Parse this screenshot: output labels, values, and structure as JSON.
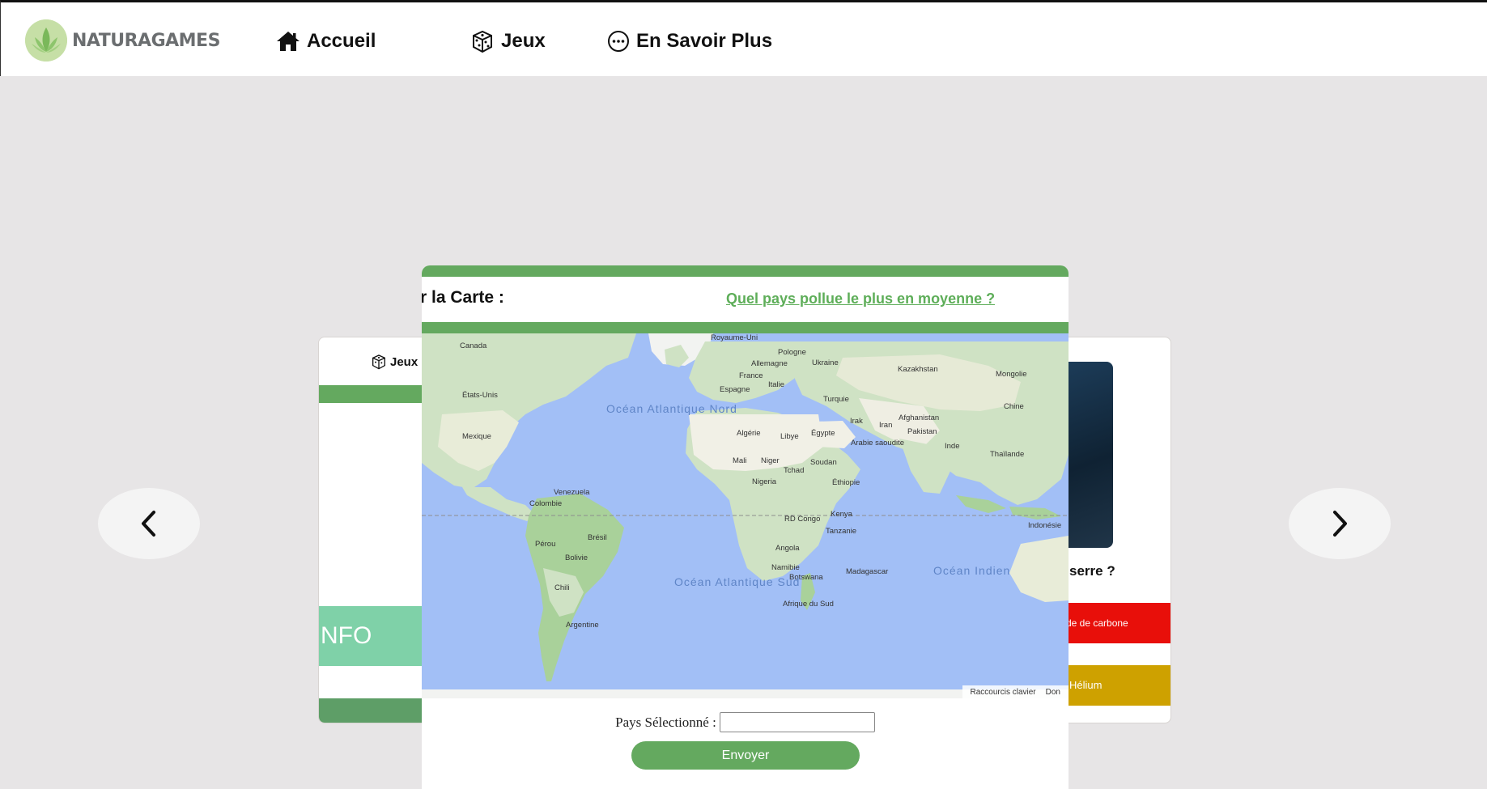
{
  "brand": {
    "logo_text": "NATURAGAMES"
  },
  "nav": [
    {
      "label": "Accueil",
      "icon": "home-icon"
    },
    {
      "label": "Jeux",
      "icon": "dice-icon"
    },
    {
      "label": "En Savoir Plus",
      "icon": "ellipsis-circle-icon"
    }
  ],
  "carousel": {
    "prev_icon": "chevron-left-icon",
    "next_icon": "chevron-right-icon"
  },
  "left_card": {
    "header_label": "Jeux",
    "info_label": "NFO"
  },
  "right_card": {
    "question_fragment": "serre ?",
    "answers": [
      {
        "label": "de de carbone",
        "color": "#e80f0a"
      },
      {
        "label": "Hélium",
        "color": "#cea100"
      }
    ]
  },
  "modal": {
    "heading": "r la Carte :",
    "link_text": "Quel pays pollue le plus en moyenne ?",
    "map": {
      "footer_links": [
        "Raccourcis clavier",
        "Don"
      ],
      "country_labels": [
        "Royaume-Uni",
        "Pologne",
        "Allemagne",
        "Ukraine",
        "Kazakhstan",
        "Mongolie",
        "France",
        "Italie",
        "Espagne",
        "Turquie",
        "Chine",
        "Canada",
        "États-Unis",
        "Mexique",
        "Afghanistan",
        "Iran",
        "Irak",
        "Pakistan",
        "Algérie",
        "Libye",
        "Égypte",
        "Arabie saoudite",
        "Inde",
        "Thaïlande",
        "Mali",
        "Niger",
        "Tchad",
        "Soudan",
        "Nigeria",
        "Éthiopie",
        "Venezuela",
        "Colombie",
        "Kenya",
        "RD Congo",
        "Indonésie",
        "Tanzanie",
        "Pérou",
        "Brésil",
        "Bolivie",
        "Angola",
        "Namibie",
        "Botswana",
        "Madagascar",
        "Chili",
        "Afrique du Sud",
        "Argentine"
      ],
      "ocean_labels": [
        "Océan Atlantique Nord",
        "Océan Atlantique Sud",
        "Océan Indien"
      ]
    },
    "form": {
      "label": "Pays Sélectionné :",
      "input_value": "",
      "submit_label": "Envoyer"
    }
  },
  "colors": {
    "accent_green": "#64a95f",
    "link_green": "#5eae59",
    "info_green": "#7fd1a8",
    "background": "#e7e5e6"
  }
}
